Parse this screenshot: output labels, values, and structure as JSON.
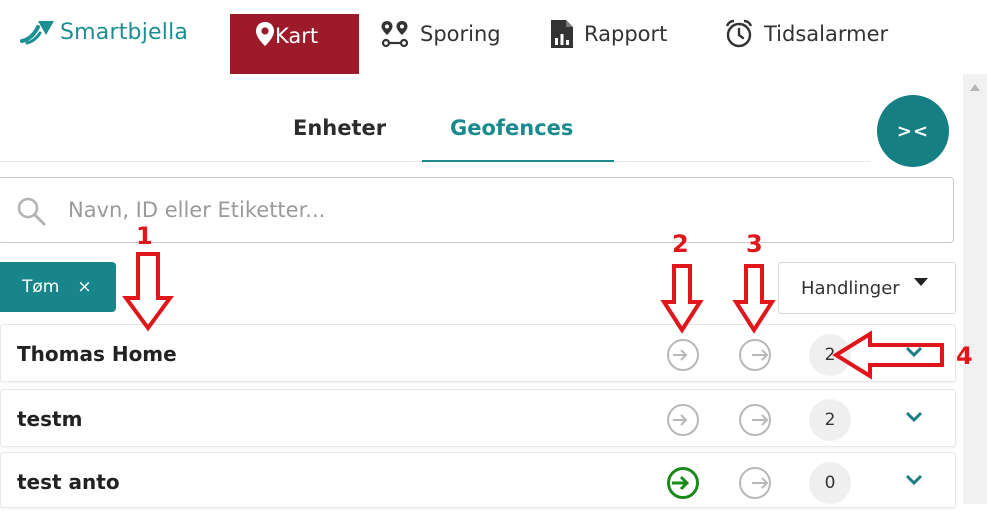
{
  "brand": {
    "name": "Smartbjella"
  },
  "nav": {
    "items": [
      {
        "label": "Kart",
        "icon": "map-pin-icon",
        "active": true
      },
      {
        "label": "Sporing",
        "icon": "route-icon",
        "active": false
      },
      {
        "label": "Rapport",
        "icon": "report-icon",
        "active": false
      },
      {
        "label": "Tidsalarmer",
        "icon": "alarm-clock-icon",
        "active": false
      }
    ]
  },
  "tabs": [
    {
      "label": "Enheter",
      "active": false
    },
    {
      "label": "Geofences",
      "active": true
    }
  ],
  "collapse_button": {
    "label": "><"
  },
  "search": {
    "placeholder": "Navn, ID eller Etiketter...",
    "value": ""
  },
  "filter_chip": {
    "label": "Tøm",
    "close": "×"
  },
  "actions_dropdown": {
    "label": "Handlinger"
  },
  "rows": [
    {
      "name": "Thomas Home",
      "enter_active": false,
      "exit_active": false,
      "count": "2"
    },
    {
      "name": "testm",
      "enter_active": false,
      "exit_active": false,
      "count": "2"
    },
    {
      "name": "test anto",
      "enter_active": true,
      "exit_active": false,
      "count": "0"
    }
  ],
  "annotations": [
    "1",
    "2",
    "3",
    "4"
  ],
  "colors": {
    "brand_teal": "#1b8f92",
    "active_nav": "#9c1a2a",
    "tab_active": "#1b8a8f",
    "chip": "#17858a",
    "enter_active": "#1a8a1a",
    "icon_inactive": "#b8b8b8",
    "annotation": "#e0161b"
  }
}
